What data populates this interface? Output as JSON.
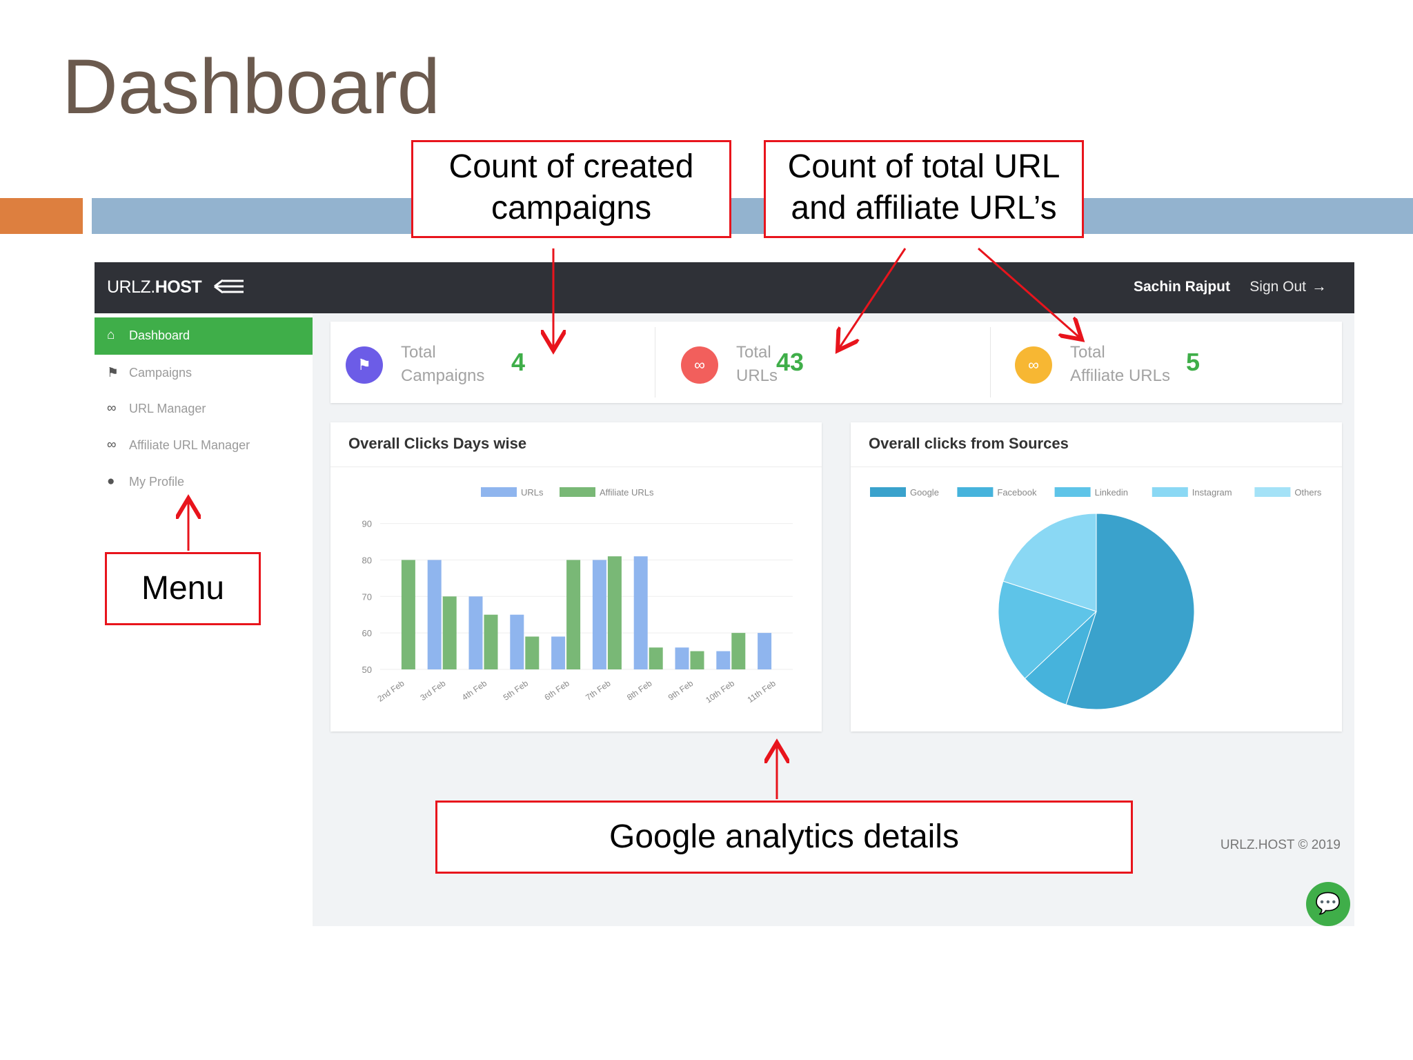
{
  "slide": {
    "title": "Dashboard"
  },
  "app": {
    "brand_light": "URLZ.",
    "brand_bold": "HOST",
    "user_name": "Sachin Rajput",
    "signout_label": "Sign Out",
    "footer": "URLZ.HOST © 2019"
  },
  "sidebar": {
    "items": [
      {
        "label": "Dashboard",
        "icon": "home-icon",
        "active": true
      },
      {
        "label": "Campaigns",
        "icon": "flag-icon",
        "active": false
      },
      {
        "label": "URL Manager",
        "icon": "link-icon",
        "active": false
      },
      {
        "label": "Affiliate URL Manager",
        "icon": "link-icon",
        "active": false
      },
      {
        "label": "My Profile",
        "icon": "user-icon",
        "active": false
      }
    ]
  },
  "stats": [
    {
      "label_line1": "Total",
      "label_line2": "Campaigns",
      "value": "4",
      "icon": "flag-icon",
      "color": "#6c5ce7"
    },
    {
      "label_line1": "Total",
      "label_line2": "URLs",
      "value": "43",
      "icon": "link-icon",
      "color": "#f25f5c"
    },
    {
      "label_line1": "Total",
      "label_line2": "Affiliate URLs",
      "value": "5",
      "icon": "link-icon",
      "color": "#f7b733"
    }
  ],
  "cards": {
    "bar_title": "Overall Clicks Days wise",
    "pie_title": "Overall clicks from Sources"
  },
  "annotations": {
    "campaigns_line1": "Count of created",
    "campaigns_line2": "campaigns",
    "urls_line1": "Count of total URL",
    "urls_line2": "and affiliate URL’s",
    "menu": "Menu",
    "analytics": "Google analytics details"
  },
  "colors": {
    "accent_green": "#3fae49",
    "topbar": "#2f3137",
    "annotation_red": "#e8141c"
  },
  "chart_data": [
    {
      "type": "bar",
      "categories": [
        "2nd Feb",
        "3rd Feb",
        "4th Feb",
        "5th Feb",
        "6th Feb",
        "7th Feb",
        "8th Feb",
        "9th Feb",
        "10th Feb",
        "11th Feb"
      ],
      "series": [
        {
          "name": "URLs",
          "color": "#8fb5ee",
          "values": [
            null,
            80,
            70,
            65,
            59,
            80,
            81,
            56,
            55,
            60
          ]
        },
        {
          "name": "Affiliate URLs",
          "color": "#79b876",
          "values": [
            80,
            70,
            65,
            59,
            80,
            81,
            56,
            55,
            60,
            null
          ]
        }
      ],
      "yticks": [
        50,
        60,
        70,
        80,
        90
      ],
      "ylim": [
        50,
        92
      ],
      "grid": true,
      "legend": "top"
    },
    {
      "type": "pie",
      "labels": [
        "Google",
        "Facebook",
        "Linkedin",
        "Instagram",
        "Others"
      ],
      "colors": [
        "#3aa2cc",
        "#46b3dc",
        "#5ec4e8",
        "#8ad8f4",
        "#a4e2f7"
      ],
      "values": [
        55,
        8,
        17,
        20,
        0
      ],
      "legend": "top"
    }
  ]
}
